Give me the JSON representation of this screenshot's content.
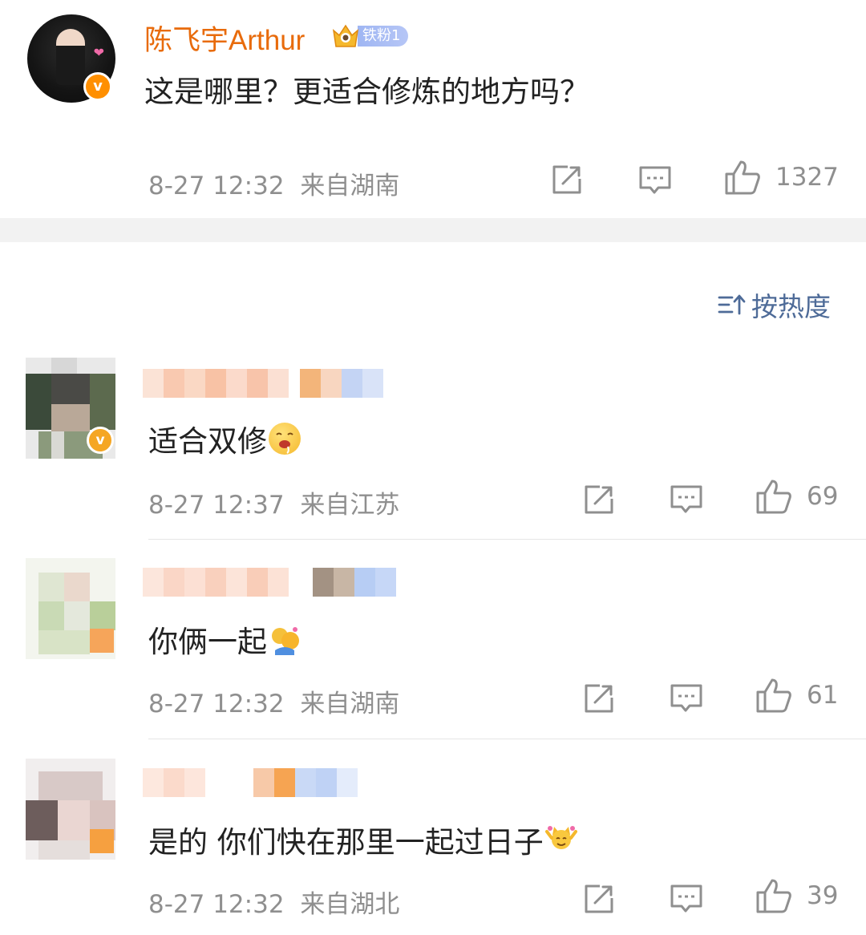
{
  "post": {
    "username": "陈飞宇Arthur",
    "fan_badge": "铁粉1",
    "text": "这是哪里？更适合修炼的地方吗？",
    "time": "8-27 12:32",
    "location": "来自湖南",
    "likes": "1327"
  },
  "sort": {
    "label": "按热度"
  },
  "comments": [
    {
      "text": "适合双修",
      "time": "8-27 12:37",
      "location": "来自江苏",
      "likes": "69"
    },
    {
      "text": "你俩一起",
      "time": "8-27 12:32",
      "location": "来自湖南",
      "likes": "61"
    },
    {
      "text": "是的 你们快在那里一起过日子",
      "time": "8-27 12:32",
      "location": "来自湖北",
      "likes": "39"
    }
  ],
  "colors": {
    "username": "#e86b0c",
    "verified": "#ff8f00",
    "fan_badge": "#9fb6f3",
    "sort": "#4e6b98",
    "meta": "#8f8f8f"
  },
  "icons": [
    "verified-badge-icon",
    "crown-icon",
    "share-icon",
    "comment-icon",
    "like-icon",
    "sort-icon"
  ]
}
